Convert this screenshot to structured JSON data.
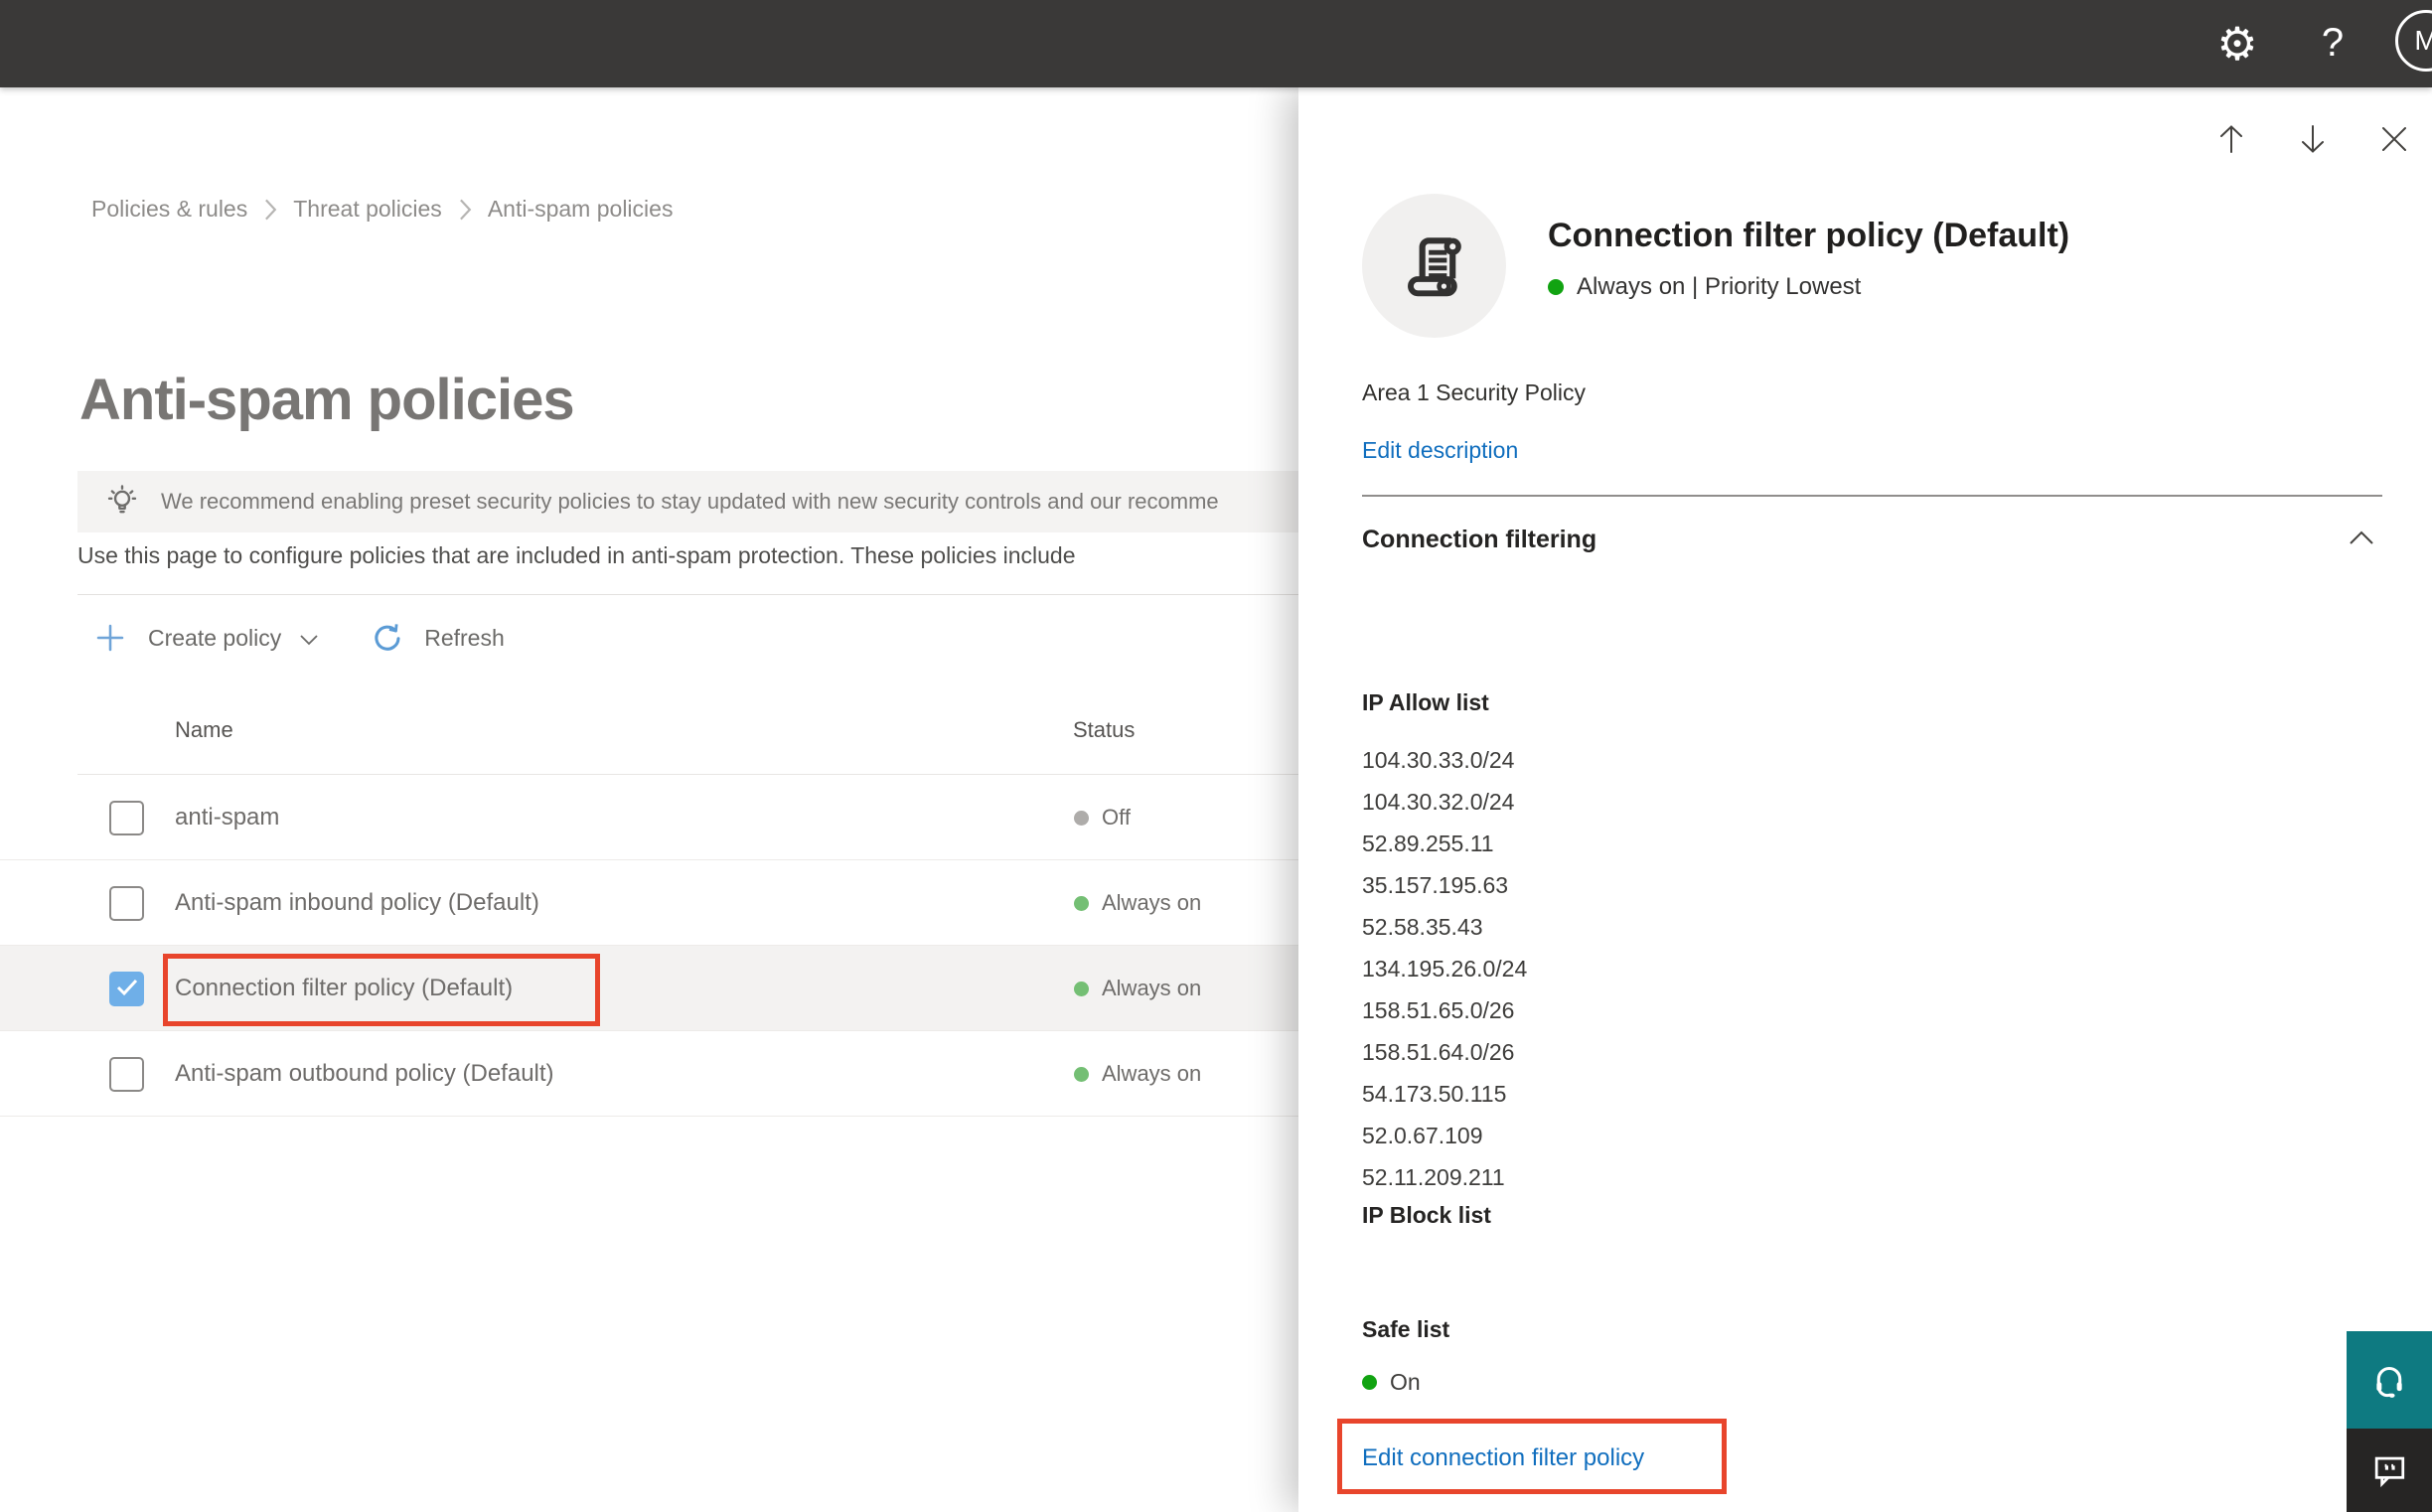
{
  "topbar": {
    "help_glyph": "?",
    "avatar_initial": "M"
  },
  "breadcrumb": {
    "items": [
      "Policies & rules",
      "Threat policies",
      "Anti-spam policies"
    ]
  },
  "page": {
    "title": "Anti-spam policies",
    "banner_text": "We recommend enabling preset security policies to stay updated with new security controls and our recomme",
    "intro_text": "Use this page to configure policies that are included in anti-spam protection. These policies include"
  },
  "toolbar": {
    "create_label": "Create policy",
    "refresh_label": "Refresh"
  },
  "table": {
    "columns": {
      "name": "Name",
      "status": "Status"
    },
    "rows": [
      {
        "name": "anti-spam",
        "status": "Off",
        "state": "off",
        "checked": false
      },
      {
        "name": "Anti-spam inbound policy (Default)",
        "status": "Always on",
        "state": "on",
        "checked": false
      },
      {
        "name": "Connection filter policy (Default)",
        "status": "Always on",
        "state": "on",
        "checked": true
      },
      {
        "name": "Anti-spam outbound policy (Default)",
        "status": "Always on",
        "state": "on",
        "checked": false
      }
    ]
  },
  "panel": {
    "title": "Connection filter policy (Default)",
    "status_line": "Always on | Priority Lowest",
    "description": "Area 1 Security Policy",
    "edit_description_label": "Edit description",
    "section_title": "Connection filtering",
    "ip_allow": {
      "title": "IP Allow list",
      "items": [
        "104.30.33.0/24",
        "104.30.32.0/24",
        "52.89.255.11",
        "35.157.195.63",
        "52.58.35.43",
        "134.195.26.0/24",
        "158.51.65.0/26",
        "158.51.64.0/26",
        "54.173.50.115",
        "52.0.67.109",
        "52.11.209.211"
      ]
    },
    "ip_block_title": "IP Block list",
    "safe_list": {
      "title": "Safe list",
      "status": "On"
    },
    "edit_link_label": "Edit connection filter policy"
  },
  "colors": {
    "accent_link": "#106ebe",
    "annotation_red": "#e8452c",
    "status_on_green": "#74bf74",
    "status_off_gray": "#aeacaa",
    "panel_green": "#11a311",
    "help_teal": "#0e7a81",
    "topbar_dark": "#3a3938",
    "selected_checkbox_blue": "#6fafe8"
  }
}
